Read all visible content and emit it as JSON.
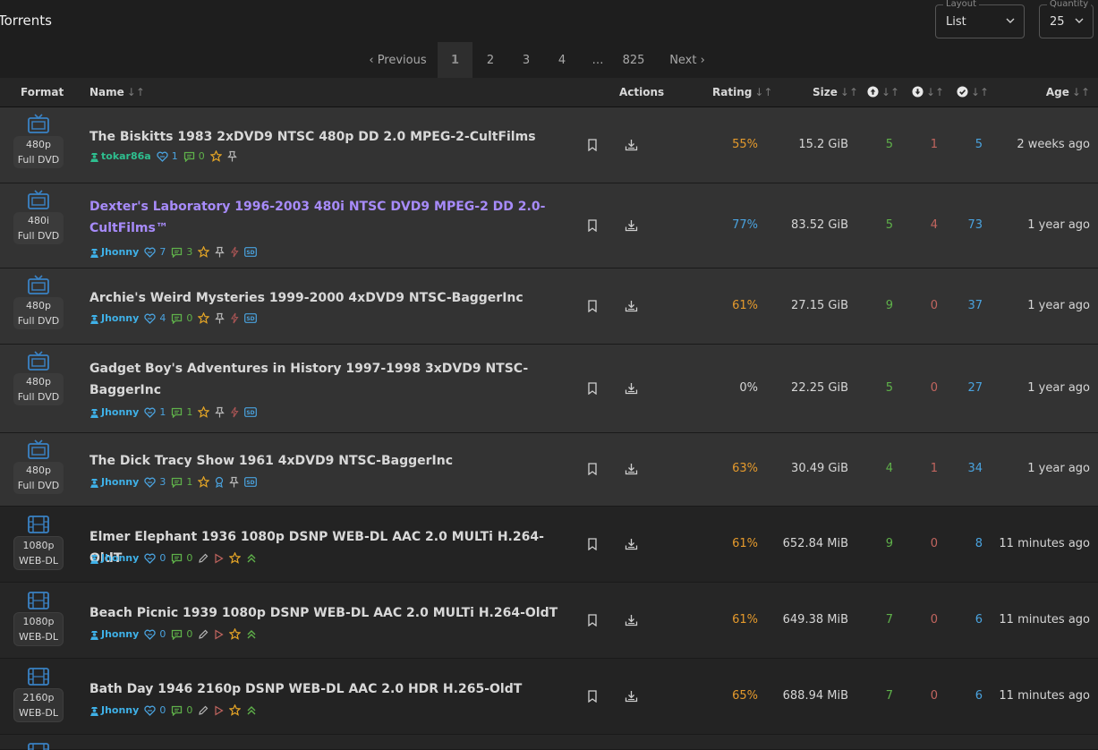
{
  "header": {
    "title": "Torrents",
    "layout_label": "Layout",
    "layout_value": "List",
    "quantity_label": "Quantity",
    "quantity_value": "25"
  },
  "pagination": {
    "previous": "‹ Previous",
    "pages": [
      "1",
      "2",
      "3",
      "4",
      "…",
      "825"
    ],
    "next": "Next ›"
  },
  "columns": {
    "format": "Format",
    "name": "Name",
    "actions": "Actions",
    "rating": "Rating",
    "size": "Size",
    "age": "Age",
    "sort_glyph": "↓↑"
  },
  "colors": {
    "rating_orange": "#e59a2c",
    "rating_blue": "#4aa3df",
    "seed_green": "#5fb14a",
    "leech_red": "#c2655f",
    "featured_purple": "#a78bfa",
    "uploader_blue": "#3fb1e8",
    "uploader_green": "#2ebf8f"
  },
  "torrents": [
    {
      "res": "480p",
      "type": "Full DVD",
      "icon": "tv-icon",
      "name": "The Biskitts 1983 2xDVD9 NTSC 480p DD 2.0 MPEG-2-CultFilms",
      "uploader": "tokar86a",
      "thanks": "1",
      "comments": "0",
      "rating": "55%",
      "size": "15.2 GiB",
      "seeders": "5",
      "leechers": "1",
      "completed": "5",
      "age": "2 weeks ago"
    },
    {
      "res": "480i",
      "type": "Full DVD",
      "icon": "tv-icon",
      "name": "Dexter's Laboratory 1996-2003 480i NTSC DVD9 MPEG-2 DD 2.0-CultFilms™",
      "uploader": "Jhonny",
      "thanks": "7",
      "comments": "3",
      "rating": "77%",
      "size": "83.52 GiB",
      "seeders": "5",
      "leechers": "4",
      "completed": "73",
      "age": "1 year ago"
    },
    {
      "res": "480p",
      "type": "Full DVD",
      "icon": "tv-icon",
      "name": "Archie's Weird Mysteries 1999-2000 4xDVD9 NTSC-BaggerInc",
      "uploader": "Jhonny",
      "thanks": "4",
      "comments": "0",
      "rating": "61%",
      "size": "27.15 GiB",
      "seeders": "9",
      "leechers": "0",
      "completed": "37",
      "age": "1 year ago"
    },
    {
      "res": "480p",
      "type": "Full DVD",
      "icon": "tv-icon",
      "name": "Gadget Boy's Adventures in History 1997-1998 3xDVD9 NTSC-BaggerInc",
      "uploader": "Jhonny",
      "thanks": "1",
      "comments": "1",
      "rating": "0%",
      "size": "22.25 GiB",
      "seeders": "5",
      "leechers": "0",
      "completed": "27",
      "age": "1 year ago"
    },
    {
      "res": "480p",
      "type": "Full DVD",
      "icon": "tv-icon",
      "name": "The Dick Tracy Show 1961 4xDVD9 NTSC-BaggerInc",
      "uploader": "Jhonny",
      "thanks": "3",
      "comments": "1",
      "rating": "63%",
      "size": "30.49 GiB",
      "seeders": "4",
      "leechers": "1",
      "completed": "34",
      "age": "1 year ago"
    },
    {
      "res": "1080p",
      "type": "WEB-DL",
      "icon": "film-icon",
      "name": "Elmer Elephant 1936 1080p DSNP WEB-DL AAC 2.0 MULTi H.264-OldT",
      "uploader": "Jhonny",
      "thanks": "0",
      "comments": "0",
      "rating": "61%",
      "size": "652.84 MiB",
      "seeders": "9",
      "leechers": "0",
      "completed": "8",
      "age": "11 minutes ago"
    },
    {
      "res": "1080p",
      "type": "WEB-DL",
      "icon": "film-icon",
      "name": "Beach Picnic 1939 1080p DSNP WEB-DL AAC 2.0 MULTi H.264-OldT",
      "uploader": "Jhonny",
      "thanks": "0",
      "comments": "0",
      "rating": "61%",
      "size": "649.38 MiB",
      "seeders": "7",
      "leechers": "0",
      "completed": "6",
      "age": "11 minutes ago"
    },
    {
      "res": "2160p",
      "type": "WEB-DL",
      "icon": "film-icon",
      "name": "Bath Day 1946 2160p DSNP WEB-DL AAC 2.0 HDR H.265-OldT",
      "uploader": "Jhonny",
      "thanks": "0",
      "comments": "0",
      "rating": "65%",
      "size": "688.94 MiB",
      "seeders": "7",
      "leechers": "0",
      "completed": "6",
      "age": "11 minutes ago"
    }
  ]
}
